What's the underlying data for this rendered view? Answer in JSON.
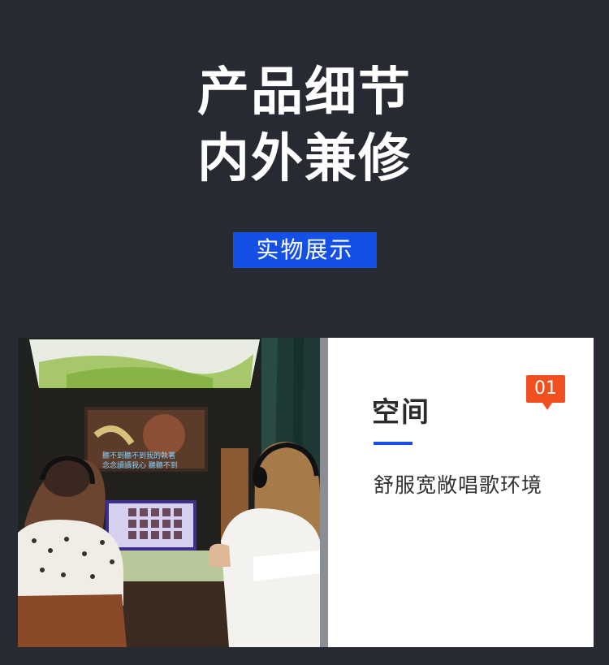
{
  "hero": {
    "line1": "产品细节",
    "line2": "内外兼修",
    "tag": "实物展示"
  },
  "feature": {
    "badge": "01",
    "title": "空间",
    "subtitle": "舒服宽敞唱歌环境"
  },
  "photo": {
    "screen_text_line1": "聽不到聽不到我的執著",
    "screen_text_line2": "念念讀讀我心 聽聽不到"
  },
  "colors": {
    "background": "#272a33",
    "accent_blue": "#1450e6",
    "badge_orange": "#f0501e"
  }
}
